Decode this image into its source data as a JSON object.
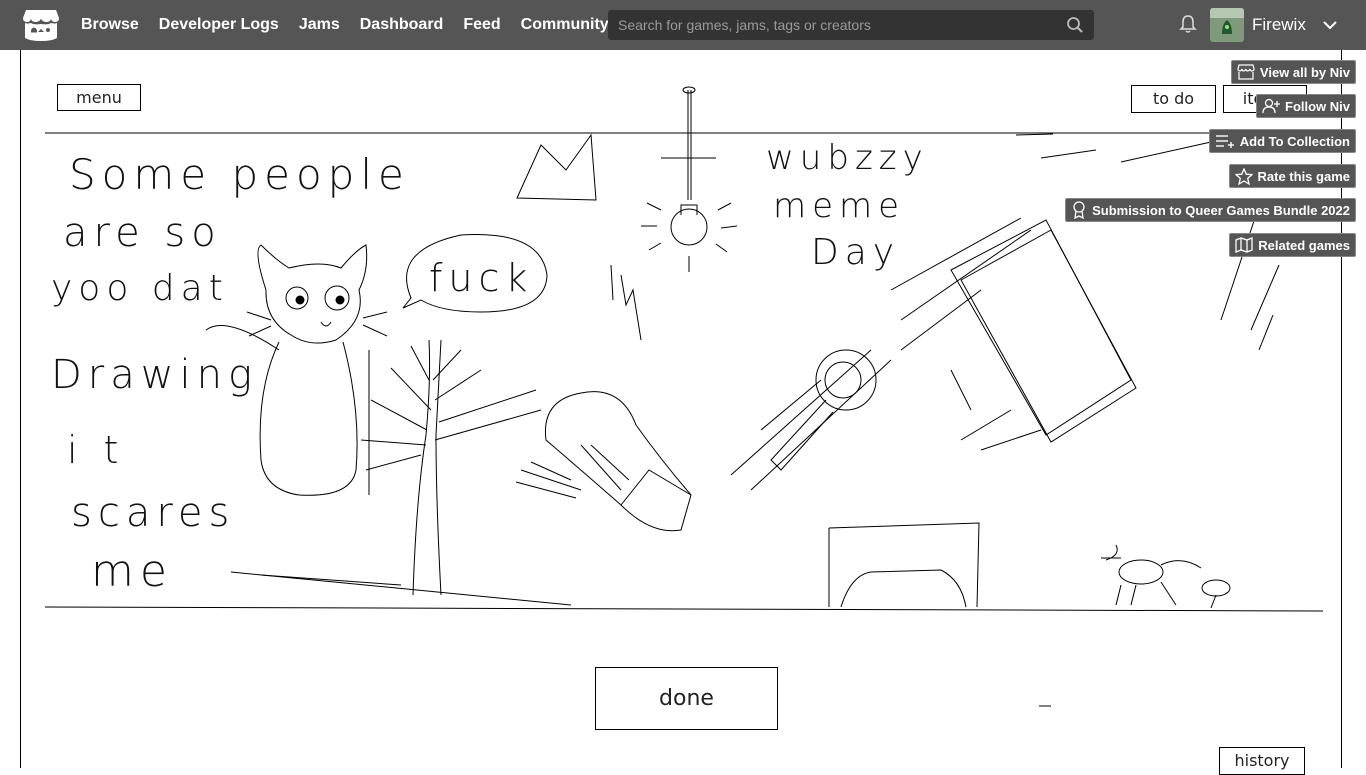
{
  "nav": {
    "links": [
      "Browse",
      "Developer Logs",
      "Jams",
      "Dashboard",
      "Feed",
      "Community"
    ],
    "search_placeholder": "Search for games, jams, tags or creators",
    "username": "Firewix",
    "bg": "#555555"
  },
  "game": {
    "menu_label": "menu",
    "todo_label": "to do",
    "items_label": "items",
    "done_label": "done",
    "history_label": "history",
    "scribble_lines": [
      "Some  people",
      "are  so",
      "yoo dat",
      "Drawing",
      "it",
      "scares",
      "me"
    ],
    "speech": "fuck",
    "top_right_text": [
      "wubzzy",
      "meme",
      "Day"
    ]
  },
  "overlay": {
    "view_all": "View all by Niv",
    "follow": "Follow Niv",
    "add_collection": "Add To Collection",
    "rate": "Rate this game",
    "submission": "Submission to Queer Games Bundle 2022",
    "related": "Related games"
  }
}
